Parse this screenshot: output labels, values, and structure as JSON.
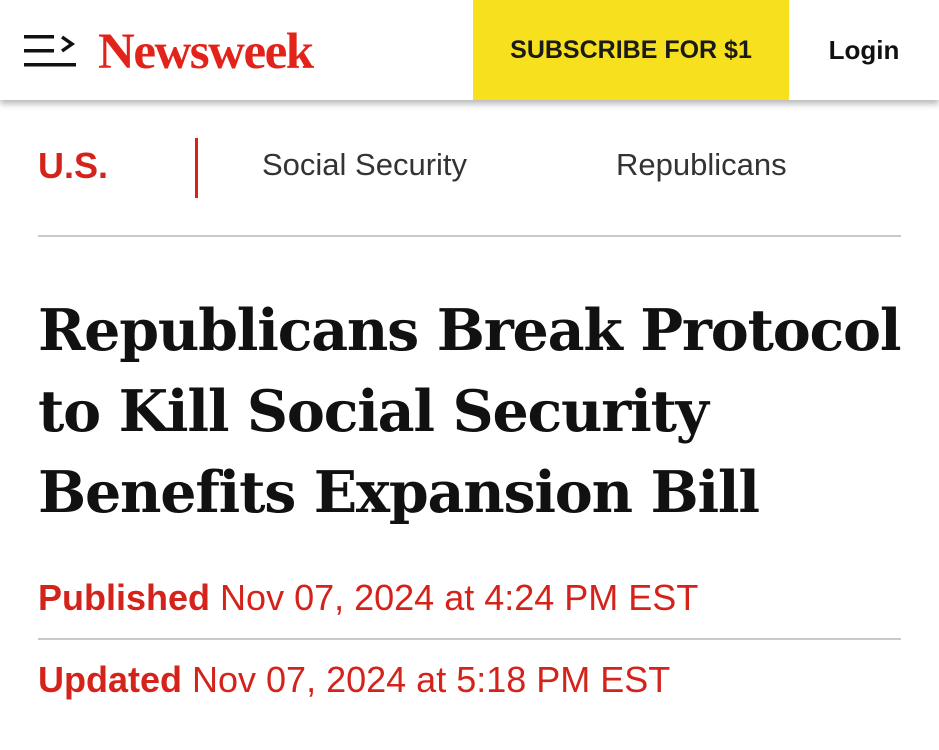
{
  "header": {
    "logo_text": "Newsweek",
    "subscribe_label": "SUBSCRIBE FOR $1",
    "login_label": "Login",
    "menu_icon": "menu-icon"
  },
  "sections": {
    "primary": "U.S.",
    "tags": [
      "Social Security",
      "Republicans"
    ]
  },
  "article": {
    "headline": "Republicans Break Protocol to Kill Social Security Benefits Expansion Bill",
    "published_label": "Published",
    "published_date": "Nov 07, 2024 at 4:24 PM EST",
    "updated_label": "Updated",
    "updated_date": "Nov 07, 2024 at 5:18 PM EST"
  },
  "colors": {
    "brand_red": "#e2231a",
    "subscribe_yellow": "#f7e01e"
  }
}
